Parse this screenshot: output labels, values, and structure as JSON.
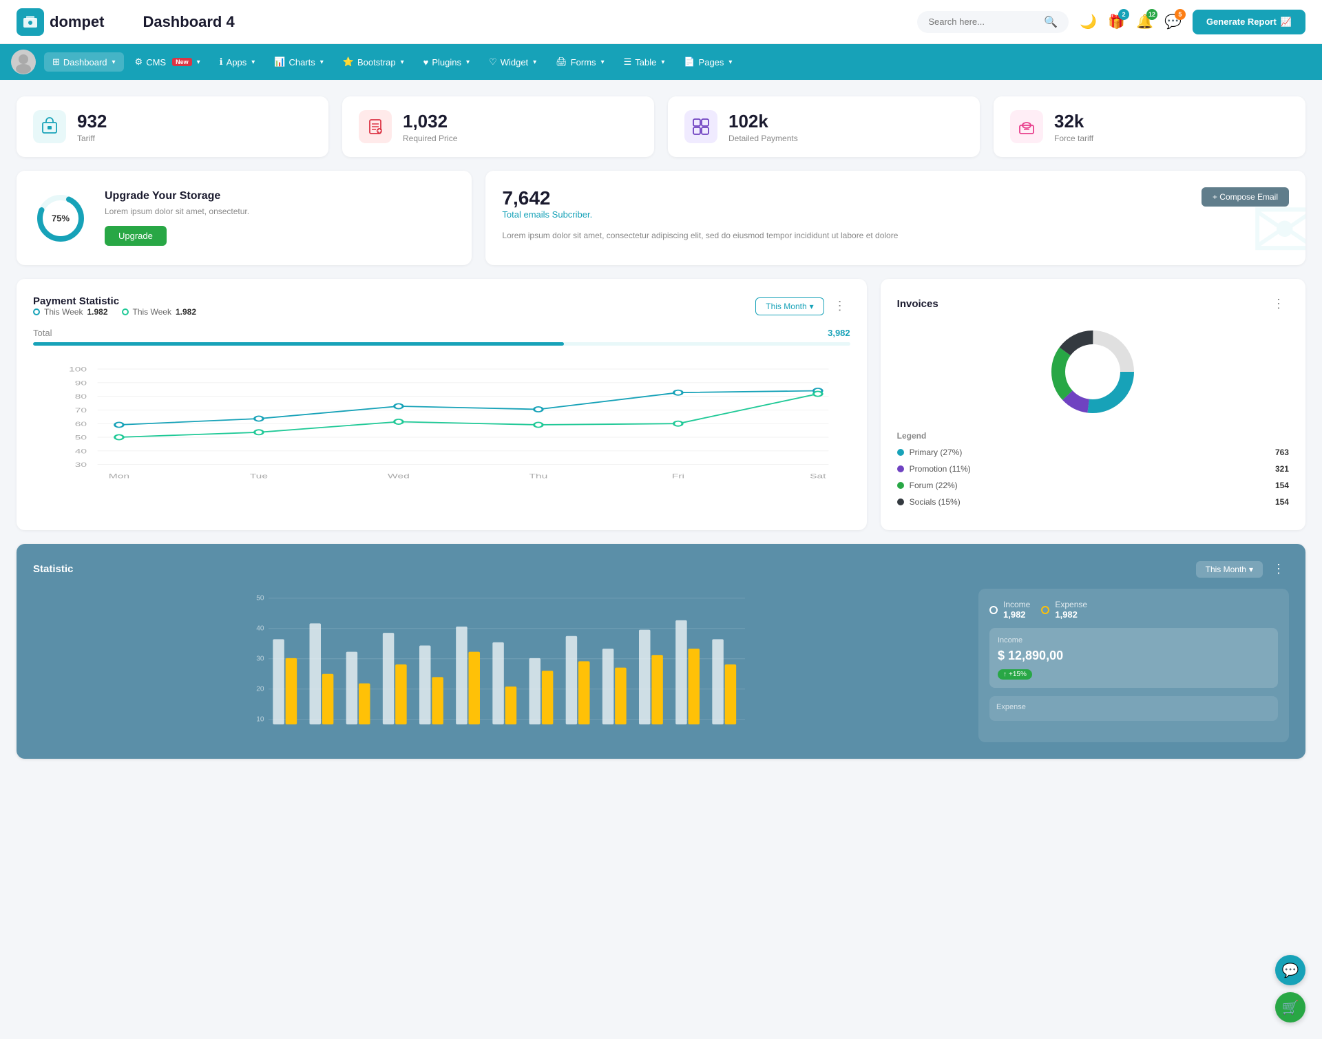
{
  "header": {
    "logo_icon": "💼",
    "logo_text": "dompet",
    "page_title": "Dashboard 4",
    "search_placeholder": "Search here...",
    "generate_btn": "Generate Report",
    "icons": {
      "search": "🔍",
      "moon": "🌙",
      "gift": "🎁",
      "bell": "🔔",
      "chat": "💬"
    },
    "badges": {
      "gift": "2",
      "bell": "12",
      "chat": "5"
    }
  },
  "nav": {
    "items": [
      {
        "id": "dashboard",
        "label": "Dashboard",
        "icon": "⊞",
        "active": true,
        "has_arrow": true,
        "badge": null
      },
      {
        "id": "cms",
        "label": "CMS",
        "icon": "⚙",
        "active": false,
        "has_arrow": true,
        "badge": "New"
      },
      {
        "id": "apps",
        "label": "Apps",
        "icon": "ℹ",
        "active": false,
        "has_arrow": true,
        "badge": null
      },
      {
        "id": "charts",
        "label": "Charts",
        "icon": "📊",
        "active": false,
        "has_arrow": true,
        "badge": null
      },
      {
        "id": "bootstrap",
        "label": "Bootstrap",
        "icon": "⭐",
        "active": false,
        "has_arrow": true,
        "badge": null
      },
      {
        "id": "plugins",
        "label": "Plugins",
        "icon": "♥",
        "active": false,
        "has_arrow": true,
        "badge": null
      },
      {
        "id": "widget",
        "label": "Widget",
        "icon": "♡",
        "active": false,
        "has_arrow": true,
        "badge": null
      },
      {
        "id": "forms",
        "label": "Forms",
        "icon": "🖨",
        "active": false,
        "has_arrow": true,
        "badge": null
      },
      {
        "id": "table",
        "label": "Table",
        "icon": "☰",
        "active": false,
        "has_arrow": true,
        "badge": null
      },
      {
        "id": "pages",
        "label": "Pages",
        "icon": "📄",
        "active": false,
        "has_arrow": true,
        "badge": null
      }
    ]
  },
  "stats": [
    {
      "id": "tariff",
      "value": "932",
      "label": "Tariff",
      "icon": "briefcase",
      "icon_class": "stat-icon-teal"
    },
    {
      "id": "required_price",
      "value": "1,032",
      "label": "Required Price",
      "icon": "file",
      "icon_class": "stat-icon-red"
    },
    {
      "id": "detailed_payments",
      "value": "102k",
      "label": "Detailed Payments",
      "icon": "grid",
      "icon_class": "stat-icon-purple"
    },
    {
      "id": "force_tariff",
      "value": "32k",
      "label": "Force tariff",
      "icon": "building",
      "icon_class": "stat-icon-pink"
    }
  ],
  "storage": {
    "percent": 75,
    "percent_label": "75%",
    "title": "Upgrade Your Storage",
    "description": "Lorem ipsum dolor sit amet, onsectetur.",
    "button_label": "Upgrade"
  },
  "email": {
    "count": "7,642",
    "subtitle": "Total emails Subcriber.",
    "description": "Lorem ipsum dolor sit amet, consectetur adipiscing elit, sed do eiusmod tempor incididunt ut labore et dolore",
    "compose_btn": "+ Compose Email"
  },
  "payment": {
    "title": "Payment Statistic",
    "legend": [
      {
        "label": "This Week",
        "value": "1,982",
        "color": "teal"
      },
      {
        "label": "This Week",
        "value": "1,982",
        "color": "green"
      }
    ],
    "filter": "This Month",
    "total_label": "Total",
    "total_value": "3,982",
    "progress": 65,
    "x_labels": [
      "Mon",
      "Tue",
      "Wed",
      "Thu",
      "Fri",
      "Sat"
    ],
    "y_labels": [
      "100",
      "90",
      "80",
      "70",
      "60",
      "50",
      "40",
      "30"
    ],
    "line1_points": "40,140 170,125 300,105 430,110 560,75 690,70",
    "line2_points": "40,105 170,118 300,85 430,110 560,110 690,75"
  },
  "invoices": {
    "title": "Invoices",
    "legend": [
      {
        "label": "Primary (27%)",
        "color": "#17a2b8",
        "value": "763"
      },
      {
        "label": "Promotion (11%)",
        "color": "#6f42c1",
        "value": "321"
      },
      {
        "label": "Forum (22%)",
        "color": "#28a745",
        "value": "154"
      },
      {
        "label": "Socials (15%)",
        "color": "#343a40",
        "value": "154"
      }
    ],
    "legend_title": "Legend"
  },
  "statistic": {
    "title": "Statistic",
    "filter": "This Month",
    "income_label": "Income",
    "income_value": "1,982",
    "expense_label": "Expense",
    "expense_value": "1,982",
    "income_box_title": "Income",
    "income_amount": "$ 12,890,00",
    "income_badge": "+15%",
    "y_labels": [
      "50",
      "40",
      "30",
      "20",
      "10"
    ],
    "expense_label2": "Expense"
  }
}
